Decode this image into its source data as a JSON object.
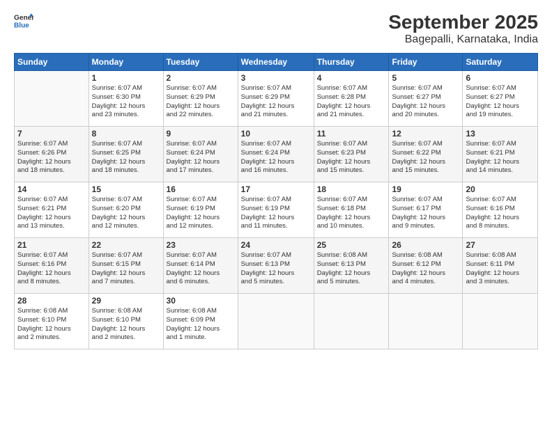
{
  "header": {
    "logo_general": "General",
    "logo_blue": "Blue",
    "title": "September 2025",
    "subtitle": "Bagepalli, Karnataka, India"
  },
  "days_of_week": [
    "Sunday",
    "Monday",
    "Tuesday",
    "Wednesday",
    "Thursday",
    "Friday",
    "Saturday"
  ],
  "weeks": [
    [
      {
        "day": "",
        "info": ""
      },
      {
        "day": "1",
        "info": "Sunrise: 6:07 AM\nSunset: 6:30 PM\nDaylight: 12 hours\nand 23 minutes."
      },
      {
        "day": "2",
        "info": "Sunrise: 6:07 AM\nSunset: 6:29 PM\nDaylight: 12 hours\nand 22 minutes."
      },
      {
        "day": "3",
        "info": "Sunrise: 6:07 AM\nSunset: 6:29 PM\nDaylight: 12 hours\nand 21 minutes."
      },
      {
        "day": "4",
        "info": "Sunrise: 6:07 AM\nSunset: 6:28 PM\nDaylight: 12 hours\nand 21 minutes."
      },
      {
        "day": "5",
        "info": "Sunrise: 6:07 AM\nSunset: 6:27 PM\nDaylight: 12 hours\nand 20 minutes."
      },
      {
        "day": "6",
        "info": "Sunrise: 6:07 AM\nSunset: 6:27 PM\nDaylight: 12 hours\nand 19 minutes."
      }
    ],
    [
      {
        "day": "7",
        "info": "Sunrise: 6:07 AM\nSunset: 6:26 PM\nDaylight: 12 hours\nand 18 minutes."
      },
      {
        "day": "8",
        "info": "Sunrise: 6:07 AM\nSunset: 6:25 PM\nDaylight: 12 hours\nand 18 minutes."
      },
      {
        "day": "9",
        "info": "Sunrise: 6:07 AM\nSunset: 6:24 PM\nDaylight: 12 hours\nand 17 minutes."
      },
      {
        "day": "10",
        "info": "Sunrise: 6:07 AM\nSunset: 6:24 PM\nDaylight: 12 hours\nand 16 minutes."
      },
      {
        "day": "11",
        "info": "Sunrise: 6:07 AM\nSunset: 6:23 PM\nDaylight: 12 hours\nand 15 minutes."
      },
      {
        "day": "12",
        "info": "Sunrise: 6:07 AM\nSunset: 6:22 PM\nDaylight: 12 hours\nand 15 minutes."
      },
      {
        "day": "13",
        "info": "Sunrise: 6:07 AM\nSunset: 6:21 PM\nDaylight: 12 hours\nand 14 minutes."
      }
    ],
    [
      {
        "day": "14",
        "info": "Sunrise: 6:07 AM\nSunset: 6:21 PM\nDaylight: 12 hours\nand 13 minutes."
      },
      {
        "day": "15",
        "info": "Sunrise: 6:07 AM\nSunset: 6:20 PM\nDaylight: 12 hours\nand 12 minutes."
      },
      {
        "day": "16",
        "info": "Sunrise: 6:07 AM\nSunset: 6:19 PM\nDaylight: 12 hours\nand 12 minutes."
      },
      {
        "day": "17",
        "info": "Sunrise: 6:07 AM\nSunset: 6:19 PM\nDaylight: 12 hours\nand 11 minutes."
      },
      {
        "day": "18",
        "info": "Sunrise: 6:07 AM\nSunset: 6:18 PM\nDaylight: 12 hours\nand 10 minutes."
      },
      {
        "day": "19",
        "info": "Sunrise: 6:07 AM\nSunset: 6:17 PM\nDaylight: 12 hours\nand 9 minutes."
      },
      {
        "day": "20",
        "info": "Sunrise: 6:07 AM\nSunset: 6:16 PM\nDaylight: 12 hours\nand 8 minutes."
      }
    ],
    [
      {
        "day": "21",
        "info": "Sunrise: 6:07 AM\nSunset: 6:16 PM\nDaylight: 12 hours\nand 8 minutes."
      },
      {
        "day": "22",
        "info": "Sunrise: 6:07 AM\nSunset: 6:15 PM\nDaylight: 12 hours\nand 7 minutes."
      },
      {
        "day": "23",
        "info": "Sunrise: 6:07 AM\nSunset: 6:14 PM\nDaylight: 12 hours\nand 6 minutes."
      },
      {
        "day": "24",
        "info": "Sunrise: 6:07 AM\nSunset: 6:13 PM\nDaylight: 12 hours\nand 5 minutes."
      },
      {
        "day": "25",
        "info": "Sunrise: 6:08 AM\nSunset: 6:13 PM\nDaylight: 12 hours\nand 5 minutes."
      },
      {
        "day": "26",
        "info": "Sunrise: 6:08 AM\nSunset: 6:12 PM\nDaylight: 12 hours\nand 4 minutes."
      },
      {
        "day": "27",
        "info": "Sunrise: 6:08 AM\nSunset: 6:11 PM\nDaylight: 12 hours\nand 3 minutes."
      }
    ],
    [
      {
        "day": "28",
        "info": "Sunrise: 6:08 AM\nSunset: 6:10 PM\nDaylight: 12 hours\nand 2 minutes."
      },
      {
        "day": "29",
        "info": "Sunrise: 6:08 AM\nSunset: 6:10 PM\nDaylight: 12 hours\nand 2 minutes."
      },
      {
        "day": "30",
        "info": "Sunrise: 6:08 AM\nSunset: 6:09 PM\nDaylight: 12 hours\nand 1 minute."
      },
      {
        "day": "",
        "info": ""
      },
      {
        "day": "",
        "info": ""
      },
      {
        "day": "",
        "info": ""
      },
      {
        "day": "",
        "info": ""
      }
    ]
  ]
}
